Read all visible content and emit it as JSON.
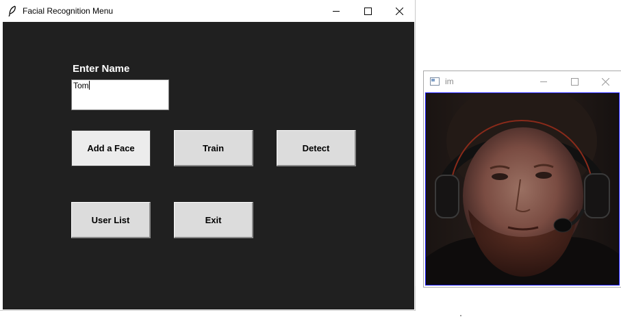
{
  "main_window": {
    "title": "Facial Recognition Menu",
    "icon": "feather-icon",
    "controls": [
      "minimize-icon",
      "maximize-icon",
      "close-icon"
    ]
  },
  "form": {
    "name_label": "Enter Name",
    "name_value": "Tom"
  },
  "buttons": {
    "add_face": "Add a Face",
    "train": "Train",
    "detect": "Detect",
    "user_list": "User List",
    "exit": "Exit"
  },
  "image_window": {
    "title": "im",
    "icon": "image-window-icon",
    "controls": [
      "minimize-icon",
      "maximize-icon",
      "close-icon"
    ],
    "content": "webcam frame"
  },
  "colors": {
    "client_bg": "#202020",
    "button_bg": "#dcdcdc",
    "frame_border": "#1a1aff"
  }
}
